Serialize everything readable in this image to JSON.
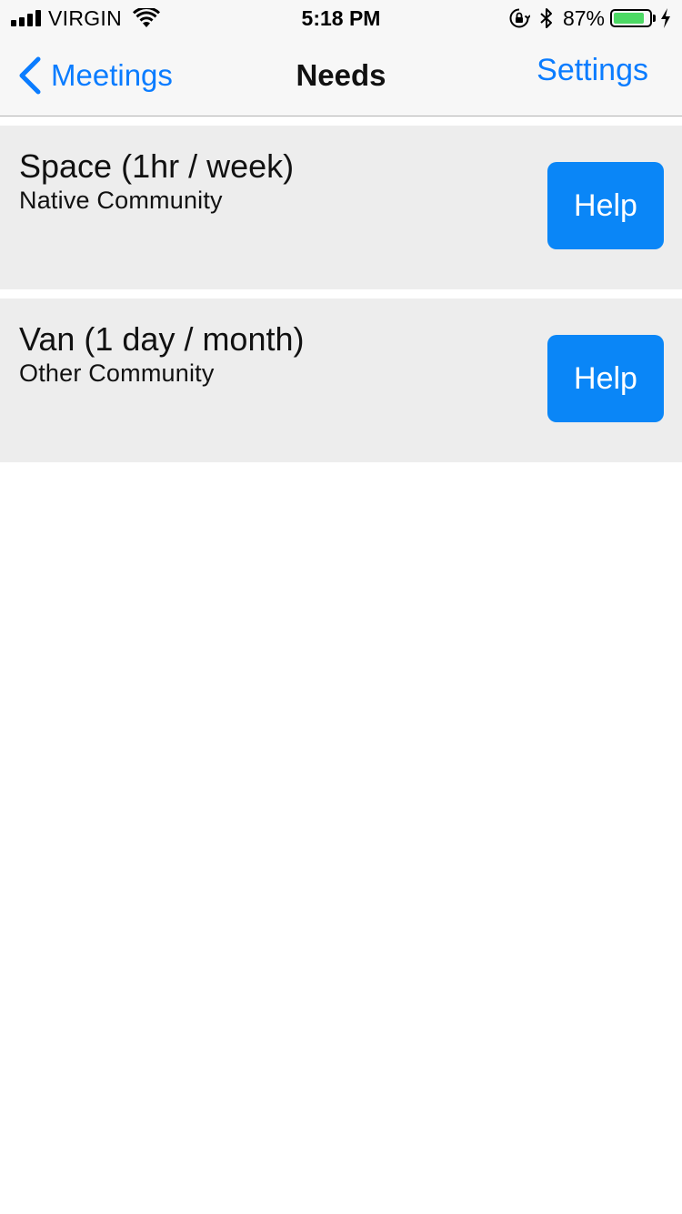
{
  "status_bar": {
    "carrier": "VIRGIN",
    "time": "5:18 PM",
    "battery_percent": "87%",
    "battery_level": 0.87,
    "battery_color": "#4cd964",
    "icons": [
      "signal-icon",
      "wifi-icon",
      "orientation-lock-icon",
      "bluetooth-icon",
      "battery-icon",
      "charging-bolt-icon"
    ]
  },
  "nav": {
    "back_label": "Meetings",
    "title": "Needs",
    "settings_label": "Settings",
    "accent_color": "#0a7cff"
  },
  "needs": [
    {
      "title": "Space (1hr / week)",
      "subtitle": "Native Community",
      "action_label": "Help"
    },
    {
      "title": "Van (1 day / month)",
      "subtitle": "Other Community",
      "action_label": "Help"
    }
  ],
  "colors": {
    "card_background": "#ededed",
    "button_background": "#0a86f7"
  }
}
